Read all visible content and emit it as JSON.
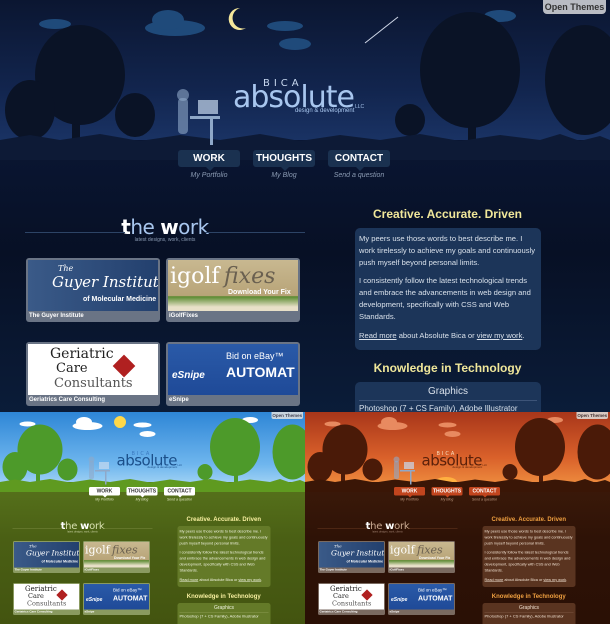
{
  "open_themes_label": "Open Themes",
  "logo": {
    "bica": "BICA",
    "name": "absolute",
    "llc": "LLC",
    "tagline": "design & development"
  },
  "nav": [
    {
      "label": "WORK",
      "sub": "My Portfolio"
    },
    {
      "label": "THOUGHTS",
      "sub": "My Blog"
    },
    {
      "label": "CONTACT",
      "sub": "Send a question"
    }
  ],
  "work": {
    "title_t": "t",
    "title_he": "he ",
    "title_w": "w",
    "title_ork": "ork",
    "subtitle": "latest designs, work, clients"
  },
  "thumbs": [
    {
      "caption": "The Guyer Institute",
      "art1": "The",
      "art2": "Guyer Institute",
      "art3": "of Molecular Medicine"
    },
    {
      "caption": "iGolfFixes",
      "art1": "igolf",
      "art2": "fixes",
      "art3": "Download Your Fix"
    },
    {
      "caption": "Geriatrics Care Consulting",
      "art1": "Geriatric",
      "art2": "Care",
      "art3": "Consultants"
    },
    {
      "caption": "eSnipe",
      "art1": "eSnipe",
      "art2": "Bid on eBay™",
      "art3": "AUTOMAT"
    }
  ],
  "about": {
    "title": "Creative. Accurate. Driven",
    "p1": "My peers use those words to best describe me. I work tirelessly to achieve my goals and continuously push myself beyond personal limits.",
    "p2": "I consistently follow the latest technological trends and embrace the advancements in web design and development, specifically with CSS and Web Standards.",
    "read_more": "Read more",
    "mid": " about Absolute Bica or ",
    "view_work": "view my work",
    "end": "."
  },
  "tech": {
    "title": "Knowledge in Technology",
    "box_title": "Graphics",
    "line": "Photoshop (7 + CS Family), Adobe Illustrator"
  },
  "themes": [
    {
      "name": "night",
      "accent": "#f0e79a"
    },
    {
      "name": "day",
      "accent": "#f8f0a0"
    },
    {
      "name": "sunset",
      "accent": "#f0a040"
    }
  ]
}
